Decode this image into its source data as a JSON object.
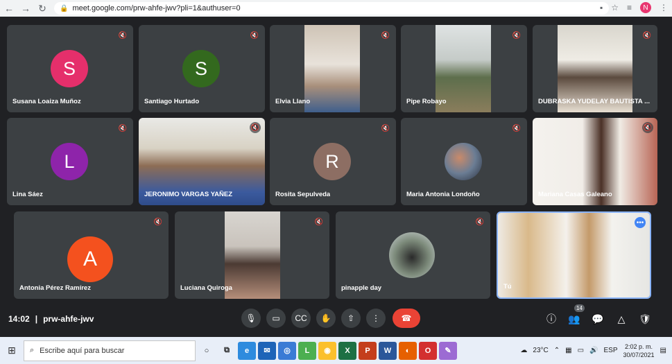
{
  "browser": {
    "url": "meet.google.com/prw-ahfe-jwv?pli=1&authuser=0",
    "profile_initial": "N"
  },
  "tiles": [
    {
      "name": "Susana Loaiza Muñoz",
      "avatar_letter": "S",
      "avatar_color": "#e52f6b"
    },
    {
      "name": "Santiago Hurtado",
      "avatar_letter": "S",
      "avatar_color": "#33691e"
    },
    {
      "name": "Elvia Llano"
    },
    {
      "name": "Pipe Robayo"
    },
    {
      "name": "DUBRASKA YUDELAY BAUTISTA ..."
    },
    {
      "name": "Lina Sáez",
      "avatar_letter": "L",
      "avatar_color": "#8e24aa"
    },
    {
      "name": "JERONIMO VARGAS YAÑEZ"
    },
    {
      "name": "Rosita Sepulveda",
      "avatar_letter": "R",
      "avatar_color": "#8d6e63"
    },
    {
      "name": "Maria Antonia Londoño"
    },
    {
      "name": "Mariana Casas Galeano"
    },
    {
      "name": "Antonia Pérez Ramírez",
      "avatar_letter": "A",
      "avatar_color": "#f4511e"
    },
    {
      "name": "Luciana Quiroga"
    },
    {
      "name": "pinapple day"
    },
    {
      "name": "Tú"
    }
  ],
  "meeting": {
    "time": "14:02",
    "separator": "|",
    "code": "prw-ahfe-jwv",
    "participants_count": "14"
  },
  "taskbar": {
    "search_placeholder": "Escribe aquí para buscar",
    "temperature": "23°C",
    "language": "ESP",
    "time": "2:02 p. m.",
    "date": "30/07/2021"
  },
  "colors": {
    "meet_bg": "#202124",
    "tile_bg": "#3c4043",
    "end_call": "#ea4335",
    "self_border": "#8ab4f8"
  }
}
